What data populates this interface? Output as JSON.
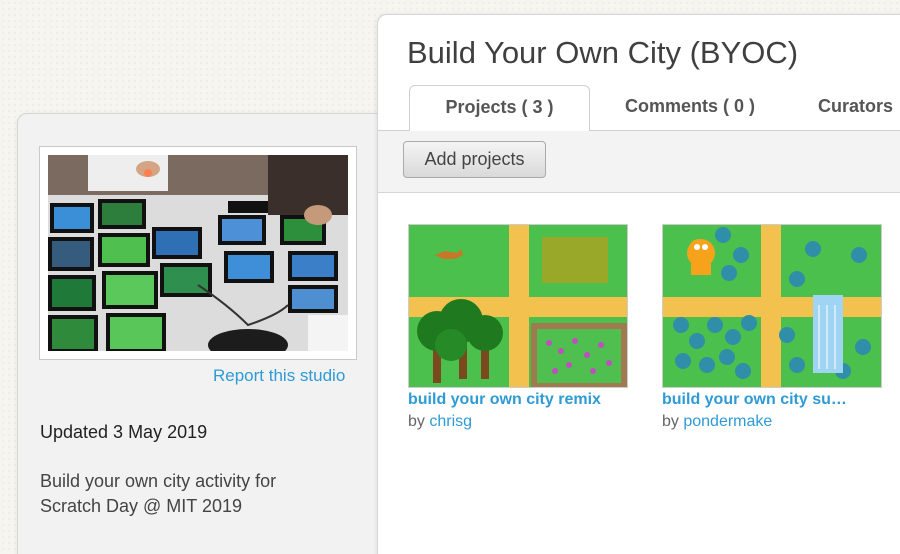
{
  "sidebar": {
    "thumbnail_alt": "photo of tablets on a table",
    "report_label": "Report this studio",
    "updated": "Updated 3 May 2019",
    "description": "Build your own city activity for Scratch Day @ MIT 2019"
  },
  "studio": {
    "title": "Build Your Own City (BYOC)",
    "tabs": [
      {
        "label": "Projects ( 3 )",
        "active": true
      },
      {
        "label": "Comments ( 0 )",
        "active": false
      },
      {
        "label": "Curators",
        "active": false
      }
    ],
    "add_projects_label": "Add projects"
  },
  "projects": [
    {
      "title": "build your own city remix",
      "by": "by ",
      "author": "chrisg"
    },
    {
      "title": "build your own city su…",
      "by": "by ",
      "author": "pondermake"
    }
  ],
  "colors": {
    "link": "#2e9ad6",
    "grass": "#4cc04c",
    "road": "#f2c14e"
  }
}
